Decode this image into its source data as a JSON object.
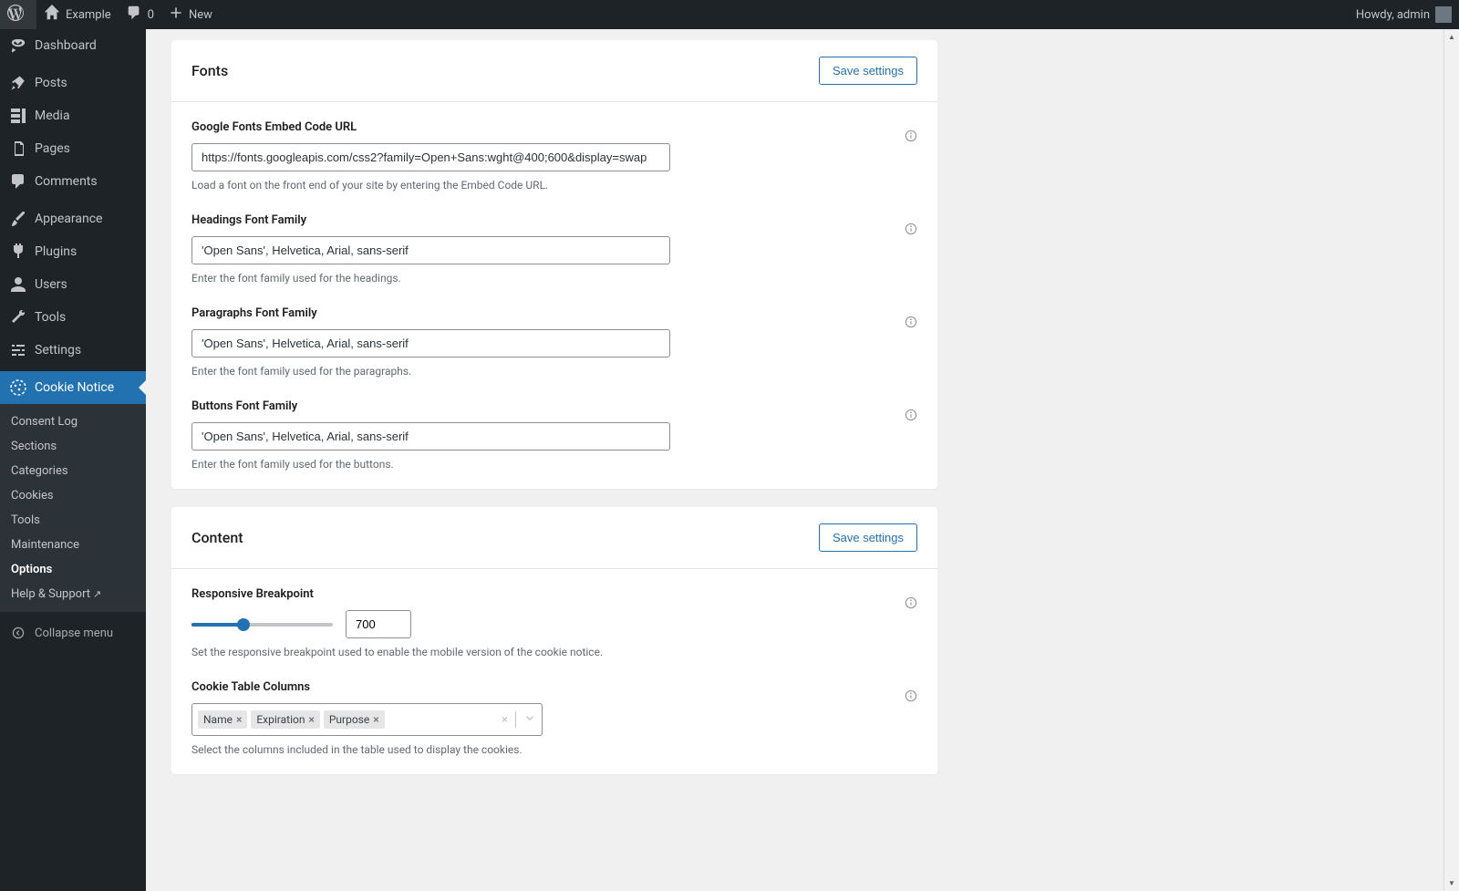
{
  "admin_bar": {
    "site_name": "Example",
    "comments_count": "0",
    "new_label": "New",
    "howdy": "Howdy, admin"
  },
  "sidebar": {
    "items": [
      {
        "label": "Dashboard"
      },
      {
        "label": "Posts"
      },
      {
        "label": "Media"
      },
      {
        "label": "Pages"
      },
      {
        "label": "Comments"
      },
      {
        "label": "Appearance"
      },
      {
        "label": "Plugins"
      },
      {
        "label": "Users"
      },
      {
        "label": "Tools"
      },
      {
        "label": "Settings"
      },
      {
        "label": "Cookie Notice"
      }
    ],
    "submenu": [
      {
        "label": "Consent Log"
      },
      {
        "label": "Sections"
      },
      {
        "label": "Categories"
      },
      {
        "label": "Cookies"
      },
      {
        "label": "Tools"
      },
      {
        "label": "Maintenance"
      },
      {
        "label": "Options"
      },
      {
        "label": "Help & Support"
      }
    ],
    "collapse": "Collapse menu"
  },
  "panels": {
    "fonts": {
      "title": "Fonts",
      "save": "Save settings",
      "fields": {
        "google_fonts": {
          "label": "Google Fonts Embed Code URL",
          "value": "https://fonts.googleapis.com/css2?family=Open+Sans:wght@400;600&display=swap",
          "desc": "Load a font on the front end of your site by entering the Embed Code URL."
        },
        "headings": {
          "label": "Headings Font Family",
          "value": "'Open Sans', Helvetica, Arial, sans-serif",
          "desc": "Enter the font family used for the headings."
        },
        "paragraphs": {
          "label": "Paragraphs Font Family",
          "value": "'Open Sans', Helvetica, Arial, sans-serif",
          "desc": "Enter the font family used for the paragraphs."
        },
        "buttons": {
          "label": "Buttons Font Family",
          "value": "'Open Sans', Helvetica, Arial, sans-serif",
          "desc": "Enter the font family used for the buttons."
        }
      }
    },
    "content": {
      "title": "Content",
      "save": "Save settings",
      "fields": {
        "breakpoint": {
          "label": "Responsive Breakpoint",
          "value": "700",
          "desc": "Set the responsive breakpoint used to enable the mobile version of the cookie notice."
        },
        "columns": {
          "label": "Cookie Table Columns",
          "tags": [
            "Name",
            "Expiration",
            "Purpose"
          ],
          "desc": "Select the columns included in the table used to display the cookies."
        }
      }
    }
  }
}
